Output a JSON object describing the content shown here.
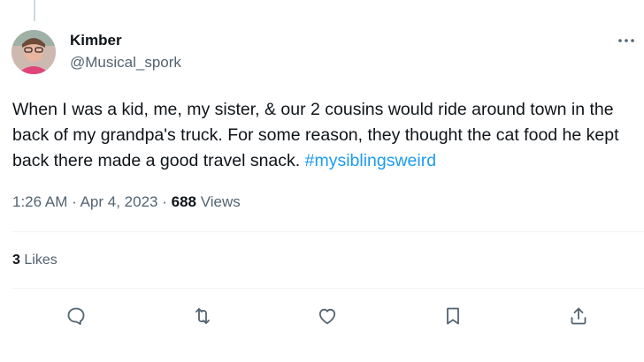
{
  "tweet": {
    "author": {
      "name": "Kimber",
      "handle": "@Musical_spork"
    },
    "text": "When I was a kid, me, my sister, & our 2 cousins would ride around town in the back of my grandpa's truck. For some reason, they thought the cat food he kept back there made a good travel snack. ",
    "hashtag": "#mysiblingsweird",
    "time": "1:26 AM",
    "separator": "·",
    "date": "Apr 4, 2023",
    "views_count": "688",
    "views_label": "Views",
    "likes_count": "3",
    "likes_label": "Likes"
  },
  "icons": {
    "more": "more-horizontal-icon",
    "reply": "reply-icon",
    "retweet": "retweet-icon",
    "like": "heart-icon",
    "bookmark": "bookmark-icon",
    "share": "share-icon"
  },
  "colors": {
    "text": "#0f1419",
    "secondary": "#536471",
    "link": "#1d9bf0",
    "divider": "#eff3f4"
  }
}
